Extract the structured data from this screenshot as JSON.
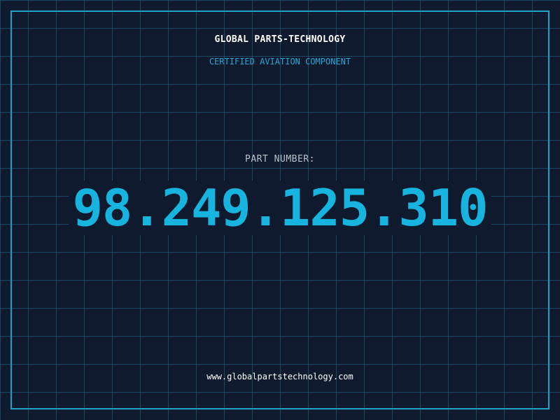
{
  "header": {
    "title": "GLOBAL PARTS-TECHNOLOGY",
    "subtitle": "CERTIFIED AVIATION COMPONENT"
  },
  "part": {
    "label": "PART NUMBER:",
    "number": "98.249.125.310"
  },
  "footer": {
    "url": "www.globalpartstechnology.com"
  },
  "colors": {
    "background": "#101a2e",
    "grid": "#286e8c",
    "accent": "#18b4e0",
    "frame": "#1ea3c8"
  }
}
